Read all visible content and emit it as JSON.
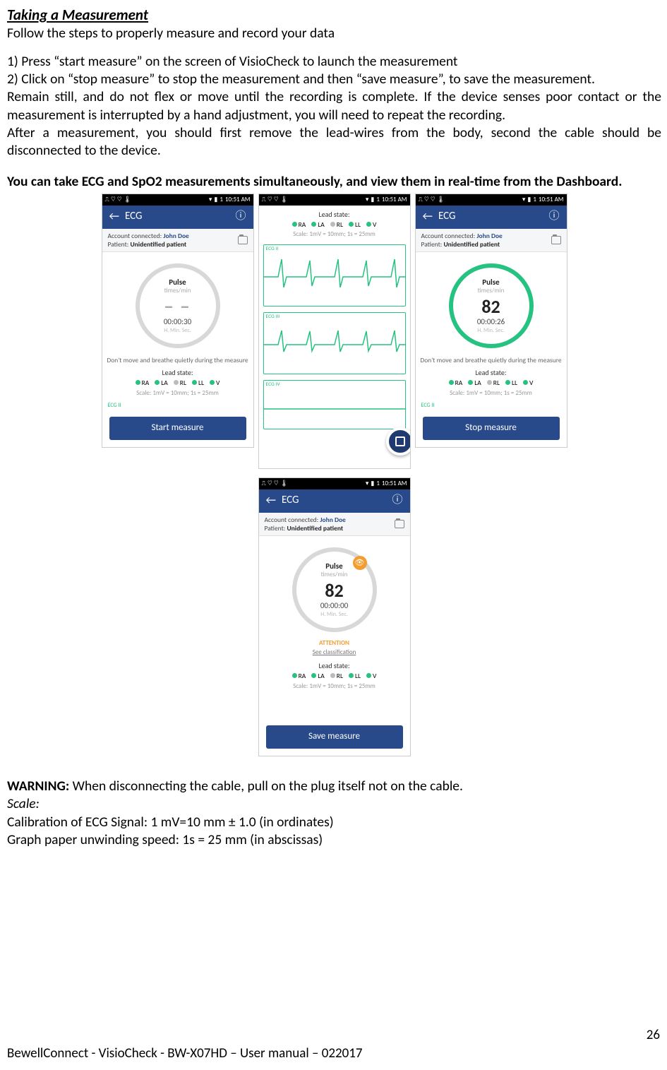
{
  "heading": "Taking a Measurement",
  "intro": "Follow the steps to properly measure and record your data",
  "step1": "1) Press “start measure” on the screen of VisioCheck to launch the measurement",
  "step2": "2) Click on “stop measure” to stop the measurement and then “save measure”, to save the measurement.",
  "remain": "Remain still, and do not flex or move until the recording is complete. If the device senses poor contact or the measurement is interrupted by a hand adjustment, you will need to repeat the recording.",
  "after": "After a measurement, you should first remove the lead-wires from the body, second the cable should be disconnected to the device.",
  "simul": "You can take ECG and SpO2 measurements simultaneously, and view them in real-time from the Dashboard.",
  "status_time": "10:51 AM",
  "status_batt": "1",
  "app_title": "ECG",
  "account_label": "Account connected: ",
  "account_name": "John Doe",
  "patient_label": "Patient: ",
  "patient_name": "Unidentified patient",
  "pulse_label": "Pulse",
  "pulse_unit": "times/min",
  "hms": "H.  Min. Sec.",
  "dont_move": "Don't move and breathe quietly during the measure",
  "lead_state": "Lead state:",
  "leads": {
    "ra": "RA",
    "la": "LA",
    "rl": "RL",
    "ll": "LL",
    "v": "V"
  },
  "scale_text": "Scale: 1mV = 10mm; 1s = 25mm",
  "ecg2": "ECG II",
  "ecg3": "ECG III",
  "ecg4": "ECG IV",
  "btn_start": "Start measure",
  "btn_stop": "Stop measure",
  "btn_save": "Save measure",
  "attention": "ATTENTION",
  "classification": "See classification",
  "s1": {
    "value": "− −",
    "time": "00:00:30"
  },
  "s3": {
    "value": "82",
    "time": "00:00:26"
  },
  "s4": {
    "value": "82",
    "time": "00:00:00"
  },
  "warning_label": "WARNING: ",
  "warning_text": "When disconnecting the cable, pull on the plug itself not on the cable.",
  "scale_label": "Scale:",
  "calib1": "Calibration of ECG Signal: 1 mV=10 mm ± 1.0 (in ordinates)",
  "calib2": "Graph paper unwinding speed: 1s = 25 mm (in abscissas)",
  "page": "26",
  "footer": "BewellConnect - VisioCheck - BW-X07HD – User manual – 022017"
}
